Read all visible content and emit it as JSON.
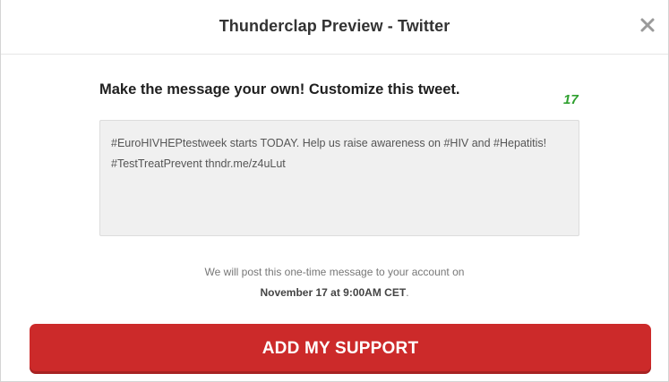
{
  "dialog": {
    "title": "Thunderclap Preview - Twitter",
    "close_icon": "close-icon"
  },
  "composer": {
    "prompt": "Make the message your own! Customize this tweet.",
    "char_count": "17",
    "char_count_color": "#2fa02f",
    "tweet_text": "#EuroHIVHEPtestweek starts TODAY. Help us raise awareness on #HIV and #Hepatitis! #TestTreatPrevent thndr.me/z4uLut"
  },
  "schedule": {
    "note": "We will post this one-time message to your account on",
    "date": "November 17 at 9:00AM CET",
    "period": "."
  },
  "action": {
    "label": "ADD MY SUPPORT",
    "color": "#cc2a2a"
  }
}
